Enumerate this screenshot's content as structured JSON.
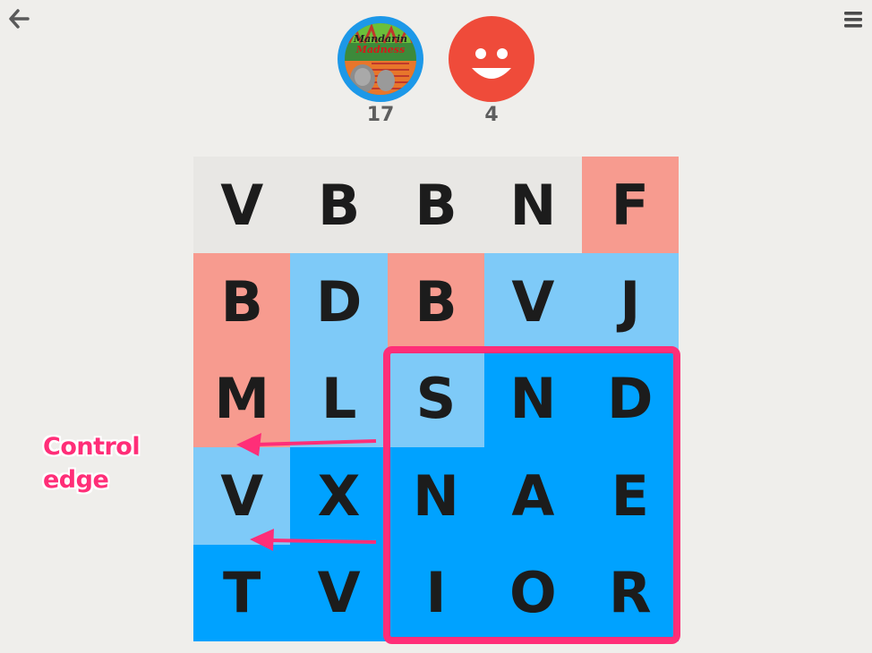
{
  "toolbar": {
    "back_icon": "arrow-left-icon",
    "menu_icon": "hamburger-menu-icon"
  },
  "players": [
    {
      "score": "17",
      "avatar": "Mandarin Madness",
      "color": "#1d98e8"
    },
    {
      "score": "4",
      "avatar": "smiley-face-icon",
      "color": "#ef4b3a"
    }
  ],
  "colors": {
    "neutral": "#e8e7e4",
    "red_light": "#f79b8f",
    "blue_light": "#7ecaf8",
    "blue_dark": "#00a2ff",
    "annotation": "#ff2e78"
  },
  "board": {
    "rows": [
      [
        {
          "letter": "V",
          "state": "neutral"
        },
        {
          "letter": "B",
          "state": "neutral"
        },
        {
          "letter": "B",
          "state": "neutral"
        },
        {
          "letter": "N",
          "state": "neutral"
        },
        {
          "letter": "F",
          "state": "red_light"
        }
      ],
      [
        {
          "letter": "B",
          "state": "red_light"
        },
        {
          "letter": "D",
          "state": "blue_light"
        },
        {
          "letter": "B",
          "state": "red_light"
        },
        {
          "letter": "V",
          "state": "blue_light"
        },
        {
          "letter": "J",
          "state": "blue_light"
        }
      ],
      [
        {
          "letter": "M",
          "state": "red_light"
        },
        {
          "letter": "L",
          "state": "blue_light"
        },
        {
          "letter": "S",
          "state": "blue_light"
        },
        {
          "letter": "N",
          "state": "blue_dark"
        },
        {
          "letter": "D",
          "state": "blue_dark"
        }
      ],
      [
        {
          "letter": "V",
          "state": "blue_light"
        },
        {
          "letter": "X",
          "state": "blue_dark"
        },
        {
          "letter": "N",
          "state": "blue_dark"
        },
        {
          "letter": "A",
          "state": "blue_dark"
        },
        {
          "letter": "E",
          "state": "blue_dark"
        }
      ],
      [
        {
          "letter": "T",
          "state": "blue_dark"
        },
        {
          "letter": "V",
          "state": "blue_dark"
        },
        {
          "letter": "I",
          "state": "blue_dark"
        },
        {
          "letter": "O",
          "state": "blue_dark"
        },
        {
          "letter": "R",
          "state": "blue_dark"
        }
      ]
    ]
  },
  "annotation": {
    "label_line1": "Control",
    "label_line2": "edge"
  }
}
